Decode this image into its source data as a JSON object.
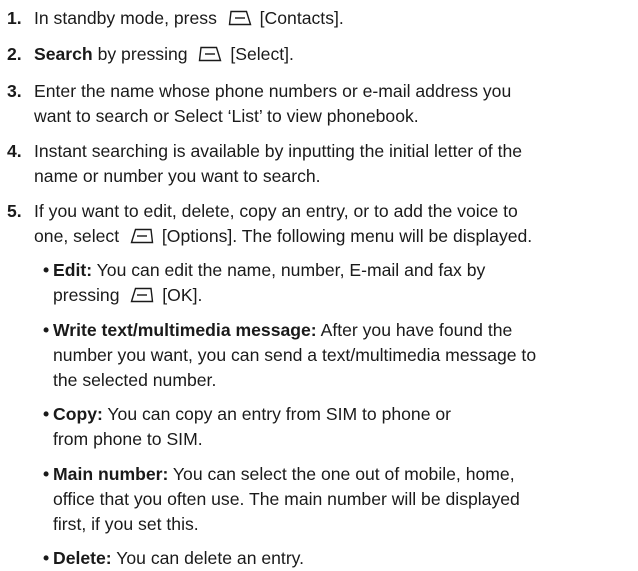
{
  "steps": [
    {
      "num": "1.",
      "before": "In standby mode, press",
      "key": "[Contacts]."
    },
    {
      "num": "2.",
      "bold": "Search",
      "rest": "by pressing",
      "key": "[Select]."
    },
    {
      "num": "3.",
      "line1": "Enter the name whose phone numbers or e-mail address you",
      "line2": "want to search or Select ‘List’ to view phonebook."
    },
    {
      "num": "4.",
      "line1": "Instant searching is available by inputting the initial letter of the",
      "line2": "name or number you want to search."
    },
    {
      "num": "5.",
      "line1": "If you want to edit, delete, copy an entry, or to add the voice to",
      "line2_before": "one, select",
      "line2_key": "[Options]. The following menu will be displayed."
    }
  ],
  "options": [
    {
      "bullet": "•",
      "title": "Edit:",
      "line1": "You can edit the name, number, E-mail and fax by",
      "line2_before": "pressing",
      "line2_key": "[OK]."
    },
    {
      "bullet": "•",
      "title": "Write text/multimedia message:",
      "line1": "After you have found the",
      "line2": "number you want, you can send a text/multimedia message to",
      "line3": "the selected number."
    },
    {
      "bullet": "•",
      "title": "Copy:",
      "line1": "You can copy an entry from SIM to phone or",
      "line2": "from phone to SIM."
    },
    {
      "bullet": "•",
      "title": "Main number:",
      "line1": "You can select the one out of mobile, home,",
      "line2": "office that you often use. The main number will be displayed",
      "line3": "first, if you set this."
    },
    {
      "bullet": "•",
      "title": "Delete:",
      "line1": "You can delete an entry."
    }
  ]
}
